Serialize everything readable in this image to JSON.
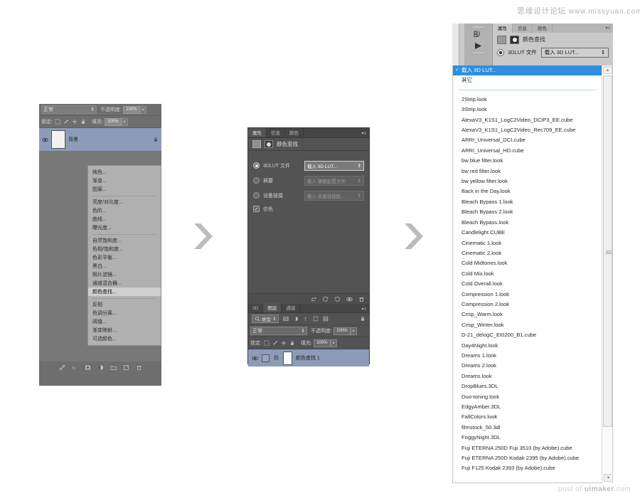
{
  "watermarks": {
    "top_cn": "思缘设计论坛",
    "top_url": "www.missyuan.com",
    "bottom_prefix": "post of ",
    "bottom_brand": "uimaker",
    "bottom_suffix": ".com"
  },
  "panel1": {
    "blend_mode": "正常",
    "opacity_label": "不透明度:",
    "opacity_value": "100%",
    "lock_label": "锁定:",
    "fill_label": "填充:",
    "fill_value": "100%",
    "layer_name": "背景",
    "lock_icon": "lock-icon",
    "eye_icon": "eye-icon",
    "adjust_menu": [
      {
        "label": "纯色...",
        "selected": false,
        "sep_after": false
      },
      {
        "label": "渐变...",
        "selected": false,
        "sep_after": false
      },
      {
        "label": "图案...",
        "selected": false,
        "sep_after": true
      },
      {
        "label": "亮度/对比度...",
        "selected": false,
        "sep_after": false
      },
      {
        "label": "色阶...",
        "selected": false,
        "sep_after": false
      },
      {
        "label": "曲线...",
        "selected": false,
        "sep_after": false
      },
      {
        "label": "曝光度...",
        "selected": false,
        "sep_after": true
      },
      {
        "label": "自然饱和度...",
        "selected": false,
        "sep_after": false
      },
      {
        "label": "色相/饱和度...",
        "selected": false,
        "sep_after": false
      },
      {
        "label": "色彩平衡...",
        "selected": false,
        "sep_after": false
      },
      {
        "label": "黑白...",
        "selected": false,
        "sep_after": false
      },
      {
        "label": "照片滤镜...",
        "selected": false,
        "sep_after": false
      },
      {
        "label": "通道混合器...",
        "selected": false,
        "sep_after": false
      },
      {
        "label": "颜色查找...",
        "selected": true,
        "sep_after": true
      },
      {
        "label": "反相",
        "selected": false,
        "sep_after": false
      },
      {
        "label": "色调分离...",
        "selected": false,
        "sep_after": false
      },
      {
        "label": "阈值...",
        "selected": false,
        "sep_after": false
      },
      {
        "label": "渐变映射...",
        "selected": false,
        "sep_after": false
      },
      {
        "label": "可选颜色...",
        "selected": false,
        "sep_after": false
      }
    ],
    "footer_icons": [
      "link-icon",
      "fx-icon",
      "mask-icon",
      "adjustment-icon",
      "group-icon",
      "new-layer-icon",
      "delete-icon"
    ]
  },
  "panel2": {
    "tabs": [
      {
        "label": "属性",
        "active": true
      },
      {
        "label": "信息",
        "active": false
      },
      {
        "label": "颜色",
        "active": false
      }
    ],
    "menu_glyph": "▾≡",
    "title": "颜色查找",
    "rows": [
      {
        "label": "3DLUT 文件",
        "value": "载入  3D LUT...",
        "selected": true
      },
      {
        "label": "摘要",
        "value": "载入 摘要配置文件",
        "selected": false
      },
      {
        "label": "设备链接",
        "value": "载入 设备链接配...",
        "selected": false
      }
    ],
    "dither_label": "仿色",
    "dither_checked": true,
    "props_footer_icons": [
      "clip-icon",
      "view-previous-icon",
      "reset-icon",
      "visibility-icon",
      "delete-icon"
    ],
    "layers_tabs": [
      {
        "label": "3D",
        "active": false
      },
      {
        "label": "图层",
        "active": true
      },
      {
        "label": "通道",
        "active": false
      }
    ],
    "filter_label": "类型",
    "filter_icons": [
      "pixel-icon",
      "adjustment-icon",
      "type-icon",
      "shape-icon",
      "smart-object-icon",
      "filter-toggle-icon"
    ],
    "blend_mode": "正常",
    "opacity_label": "不透明度:",
    "opacity_value": "100%",
    "lock_label": "锁定:",
    "fill_label": "填充:",
    "fill_value": "100%",
    "layer_name": "颜色查找 1"
  },
  "panel3": {
    "tabs": [
      {
        "label": "属性",
        "active": true
      },
      {
        "label": "信息",
        "active": false
      },
      {
        "label": "颜色",
        "active": false
      }
    ],
    "menu_glyph": "▾≡",
    "title": "颜色查找",
    "radio_label": "3DLUT 文件",
    "combo_value": "载入  3D LUT...",
    "combo_arrow": "⇕",
    "top_options": [
      {
        "label": "载入 3D LUT...",
        "selected": true
      },
      {
        "label": "其它",
        "selected": false
      }
    ],
    "luts": [
      "2Strip.look",
      "3Strip.look",
      "AlexaV3_K1S1_LogC2Video_DCIP3_EE.cube",
      "AlexaV3_K1S1_LogC2Video_Rec709_EE.cube",
      "ARRI_Universal_DCI.cube",
      "ARRI_Universal_HD.cube",
      "bw blue filter.look",
      "bw red filter.look",
      "bw yellow filter.look",
      "Back in the Day.look",
      "Bleach Bypass 1.look",
      "Bleach Bypass 2.look",
      "Bleach Bypass.look",
      "Candlelight.CUBE",
      "Cinematic 1.look",
      "Cinematic 2.look",
      "Cold Midtones.look",
      "Cold Mix.look",
      "Cold Overall.look",
      "Compression 1.look",
      "Compression 2.look",
      "Crisp_Warm.look",
      "Crisp_Winter.look",
      "D-21_delogC_EI0200_B1.cube",
      "Day4Night.look",
      "Dreams 1.look",
      "Dreams 2.look",
      "Dreams.look",
      "DropBlues.3DL",
      "Duo-toning.look",
      "EdgyAmber.3DL",
      "FallColors.look",
      "filmstock_50.3dl",
      "FoggyNight.3DL",
      "Fuji ETERNA 250D Fuji 3510 (by Adobe).cube",
      "Fuji ETERNA 250D Kodak 2395 (by Adobe).cube",
      "Fuji F125 Kodak 2393 (by Adobe).cube"
    ],
    "scroll_up_glyph": "▲",
    "scroll_down_glyph": "▼"
  },
  "arrows": [
    {
      "name": "flow-arrow-1"
    },
    {
      "name": "flow-arrow-2"
    }
  ],
  "colors": {
    "highlight": "#2e8fe0",
    "layer_selected": "#8c9cb8",
    "panel_dark": "#535353",
    "panel_light": "#c9c9c9"
  }
}
